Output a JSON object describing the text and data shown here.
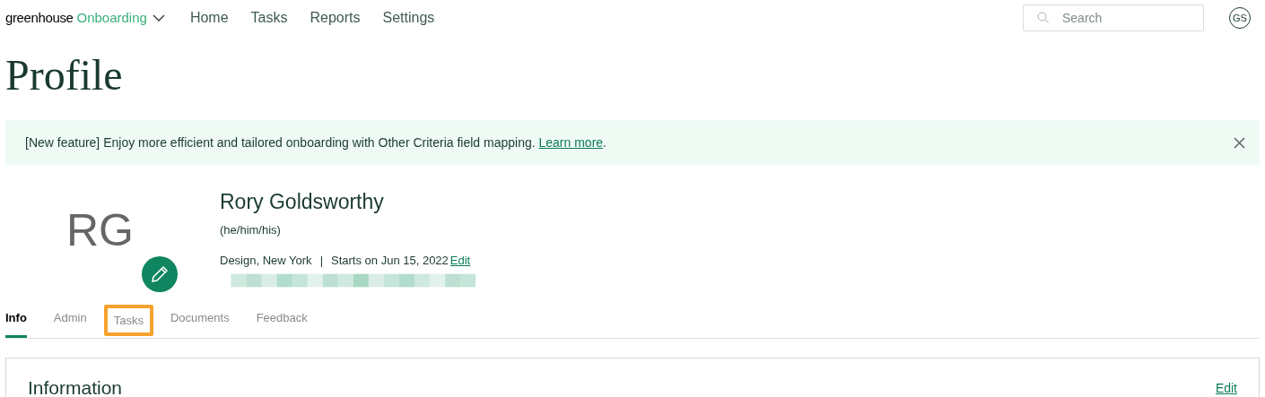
{
  "header": {
    "logo": "greenhouse",
    "product": "Onboarding",
    "nav": [
      "Home",
      "Tasks",
      "Reports",
      "Settings"
    ],
    "search": {
      "placeholder": "Search"
    },
    "user_initials": "GS"
  },
  "page_title": "Profile",
  "banner": {
    "text": "[New feature] Enjoy more efficient and tailored onboarding with Other Criteria field mapping. ",
    "link": "Learn more",
    "end": "."
  },
  "profile": {
    "initials": "RG",
    "name": "Rory Goldsworthy",
    "pronouns": "(he/him/his)",
    "location": "Design, New York",
    "separator": "|",
    "start": "Starts on Jun 15, 2022",
    "edit": "Edit"
  },
  "tabs": [
    {
      "label": "Info",
      "selected": true,
      "highlighted": false
    },
    {
      "label": "Admin",
      "selected": false,
      "highlighted": false
    },
    {
      "label": "Tasks",
      "selected": false,
      "highlighted": true
    },
    {
      "label": "Documents",
      "selected": false,
      "highlighted": false
    },
    {
      "label": "Feedback",
      "selected": false,
      "highlighted": false
    }
  ],
  "card": {
    "title": "Information",
    "edit": "Edit"
  }
}
